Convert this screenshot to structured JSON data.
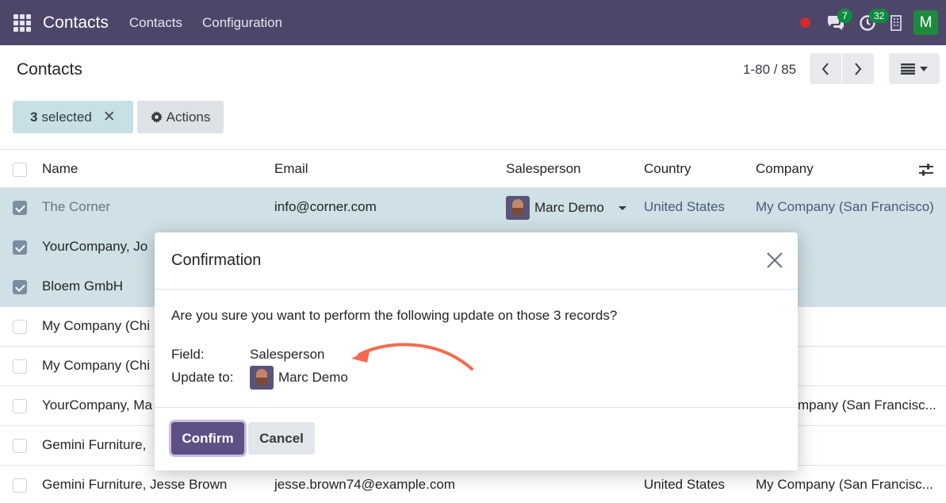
{
  "navbar": {
    "brand": "Contacts",
    "menu": [
      "Contacts",
      "Configuration"
    ],
    "messages_count": "7",
    "activities_count": "32",
    "user_initial": "M",
    "brand_color": "#4d4669"
  },
  "control": {
    "title": "Contacts",
    "pager": "1-80 / 85",
    "selected_count": "3",
    "selected_label": "selected",
    "actions_label": "Actions"
  },
  "table": {
    "columns": [
      "Name",
      "Email",
      "Salesperson",
      "Country",
      "Company"
    ],
    "rows": [
      {
        "name": "The Corner",
        "email": "info@corner.com",
        "salesperson": "Marc Demo",
        "country": "United States",
        "company": "My Company (San Francisco)",
        "checked": true
      },
      {
        "name": "YourCompany, Jo",
        "email": "",
        "salesperson": "",
        "country": "",
        "company": "",
        "checked": true
      },
      {
        "name": "Bloem GmbH",
        "email": "",
        "salesperson": "",
        "country": "",
        "company": "",
        "checked": true
      },
      {
        "name": "My Company (Chi",
        "email": "",
        "salesperson": "",
        "country": "",
        "company": "",
        "checked": false
      },
      {
        "name": "My Company (Chi",
        "email": "",
        "salesperson": "",
        "country": "",
        "company": "",
        "checked": false
      },
      {
        "name": "YourCompany, Ma",
        "email": "",
        "salesperson": "",
        "country": "",
        "company": "mpany (San Francisc...",
        "checked": false
      },
      {
        "name": "Gemini Furniture,",
        "email": "",
        "salesperson": "",
        "country": "",
        "company": "",
        "checked": false
      },
      {
        "name": "Gemini Furniture, Jesse Brown",
        "email": "jesse.brown74@example.com",
        "salesperson": "",
        "country": "United States",
        "company": "My Company (San Francisc...",
        "checked": false
      }
    ]
  },
  "modal": {
    "title": "Confirmation",
    "question": "Are you sure you want to perform the following update on those 3 records?",
    "field_label": "Field:",
    "field_value": "Salesperson",
    "update_label": "Update to:",
    "update_value": "Marc Demo",
    "confirm_label": "Confirm",
    "cancel_label": "Cancel",
    "arrow_color": "#f26b50"
  }
}
